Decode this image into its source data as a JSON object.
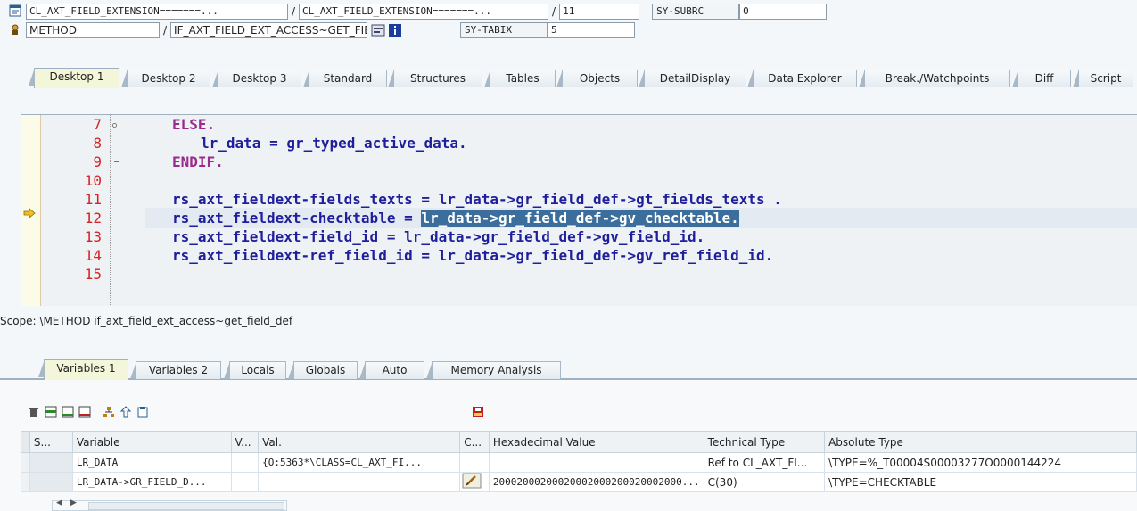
{
  "header": {
    "program_field1": "CL_AXT_FIELD_EXTENSION=======...",
    "program_field2": "CL_AXT_FIELD_EXTENSION=======...",
    "line_field": "11",
    "event_type": "METHOD",
    "event_name": "IF_AXT_FIELD_EXT_ACCESS~GET_FIELD_DEF (CL_AXT...",
    "sysvars": [
      {
        "name": "SY-SUBRC",
        "value": "0"
      },
      {
        "name": "SY-TABIX",
        "value": "5"
      }
    ]
  },
  "desktop_tabs": [
    "Desktop 1",
    "Desktop 2",
    "Desktop 3",
    "Standard",
    "Structures",
    "Tables",
    "Objects",
    "DetailDisplay",
    "Data Explorer",
    "Break./Watchpoints",
    "Diff",
    "Script"
  ],
  "editor": {
    "lines": [
      {
        "num": "7",
        "code": "ELSE."
      },
      {
        "num": "8",
        "code": "lr_data = gr_typed_active_data."
      },
      {
        "num": "9",
        "code": "ENDIF."
      },
      {
        "num": "10",
        "code": ""
      },
      {
        "num": "11",
        "code": "rs_axt_fieldext-fields_texts = lr_data->gr_field_def->gt_fields_texts ."
      },
      {
        "num": "12",
        "code_plain": "rs_axt_fieldext-checktable = ",
        "code_selected": "lr_data->gr_field_def->gv_checktable."
      },
      {
        "num": "13",
        "code": "rs_axt_fieldext-field_id = lr_data->gr_field_def->gv_field_id."
      },
      {
        "num": "14",
        "code": "rs_axt_fieldext-ref_field_id = lr_data->gr_field_def->gv_ref_field_id."
      }
    ]
  },
  "scope_text": "Scope: \\METHOD if_axt_field_ext_access~get_field_def",
  "var_tabs": [
    "Variables 1",
    "Variables 2",
    "Locals",
    "Globals",
    "Auto",
    "Memory Analysis"
  ],
  "table": {
    "headers": [
      "S...",
      "Variable",
      "V...",
      "Val.",
      "C...",
      "Hexadecimal Value",
      "Technical Type",
      "Absolute Type"
    ],
    "rows": [
      {
        "variable": "LR_DATA",
        "value": "{O:5363*\\CLASS=CL_AXT_FI...",
        "hex": "",
        "tech": "Ref to CL_AXT_FI...",
        "abs": "\\TYPE=%_T00004S00003277O0000144224"
      },
      {
        "variable": "LR_DATA->GR_FIELD_D...",
        "value": "",
        "hex": "20002000200020002000200020002000...",
        "tech": "C(30)",
        "abs": "\\TYPE=CHECKTABLE"
      }
    ]
  },
  "colors": {
    "accent": "#3b6e9c",
    "line_number": "#d62222",
    "keyword": "#9a2a8c"
  }
}
